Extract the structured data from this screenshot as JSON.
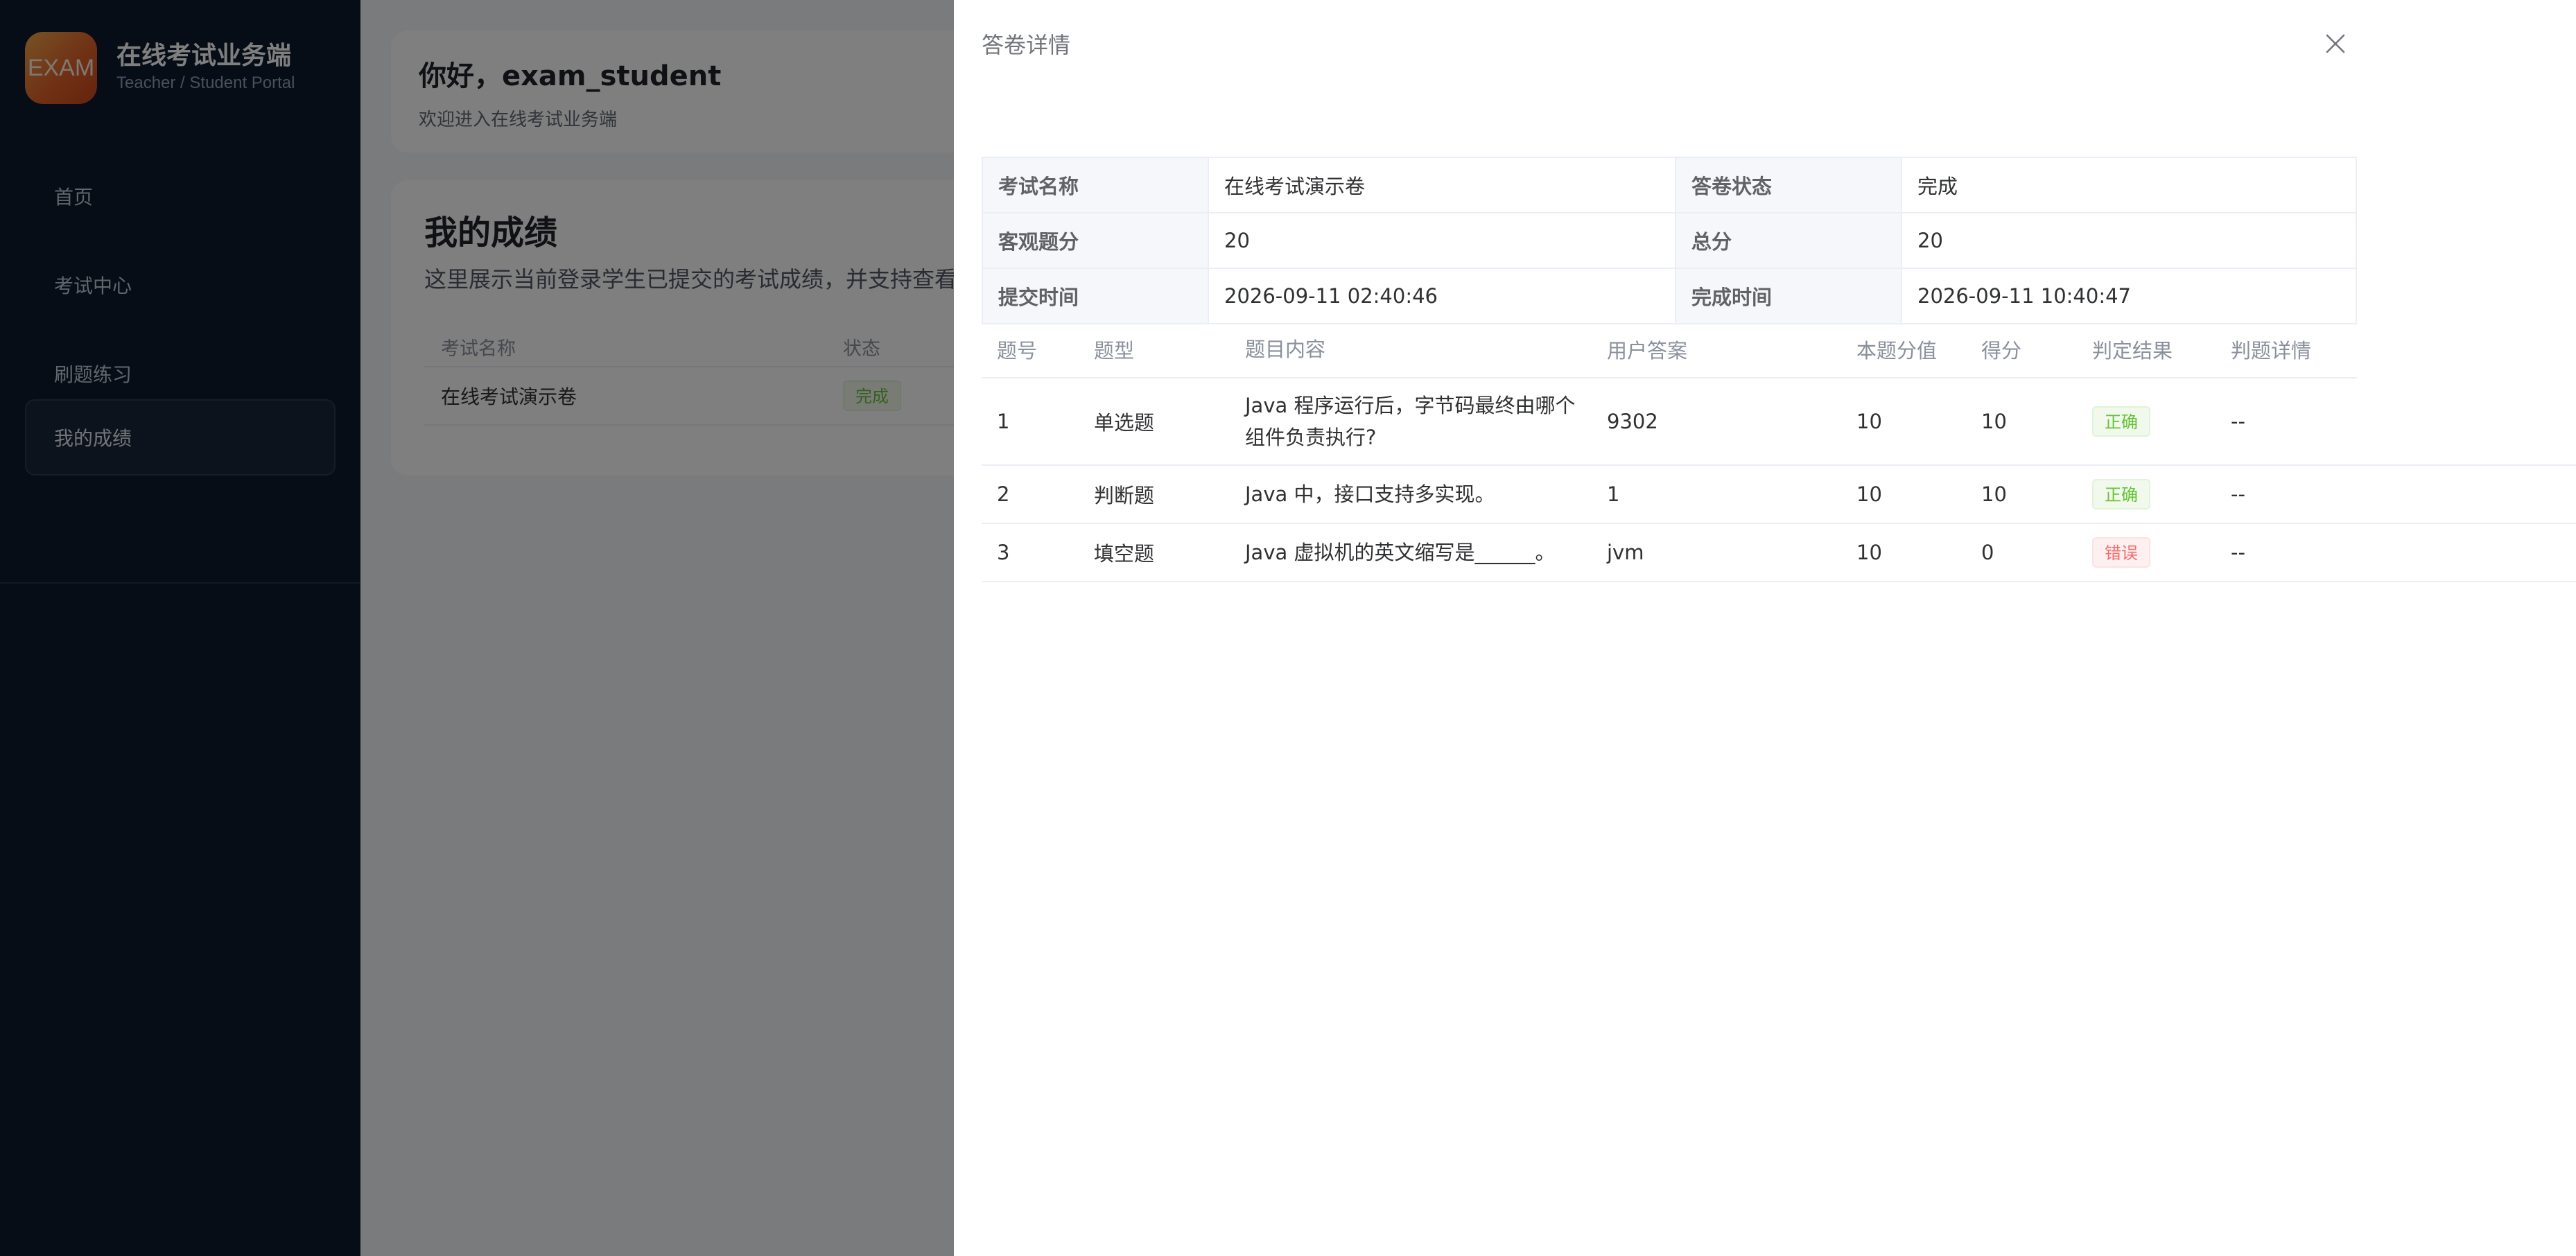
{
  "app": {
    "logo_text": "EXAM",
    "title": "在线考试业务端",
    "subtitle": "Teacher / Student Portal"
  },
  "sidebar": {
    "items": [
      {
        "label": "首页"
      },
      {
        "label": "考试中心"
      },
      {
        "label": "刷题练习"
      },
      {
        "label": "我的成绩",
        "active": true
      }
    ]
  },
  "welcome": {
    "title": "你好，exam_student",
    "subtitle": "欢迎进入在线考试业务端"
  },
  "scores": {
    "title": "我的成绩",
    "description": "这里展示当前登录学生已提交的考试成绩，并支持查看",
    "columns": [
      "考试名称",
      "状态"
    ],
    "rows": [
      {
        "name": "在线考试演示卷",
        "status": "完成"
      }
    ]
  },
  "drawer": {
    "title": "答卷详情",
    "summary": {
      "exam_name_label": "考试名称",
      "exam_name": "在线考试演示卷",
      "status_label": "答卷状态",
      "status": "完成",
      "objective_label": "客观题分",
      "objective": "20",
      "total_label": "总分",
      "total": "20",
      "submit_label": "提交时间",
      "submit_time": "2026-09-11 02:40:46",
      "finish_label": "完成时间",
      "finish_time": "2026-09-11 10:40:47"
    },
    "columns": [
      "题号",
      "题型",
      "题目内容",
      "用户答案",
      "本题分值",
      "得分",
      "判定结果",
      "判题详情"
    ],
    "rows": [
      {
        "no": "1",
        "type": "单选题",
        "content": "Java 程序运行后，字节码最终由哪个组件负责执行?",
        "answer": "9302",
        "score": "10",
        "got": "10",
        "result": "正确",
        "detail": "--"
      },
      {
        "no": "2",
        "type": "判断题",
        "content": "Java 中，接口支持多实现。",
        "answer": "1",
        "score": "10",
        "got": "10",
        "result": "正确",
        "detail": "--"
      },
      {
        "no": "3",
        "type": "填空题",
        "content": "Java 虚拟机的英文缩写是______。",
        "answer": "jvm",
        "score": "10",
        "got": "0",
        "result": "错误",
        "detail": "--"
      }
    ]
  },
  "colors": {
    "sidebar_bg": "#0f1a2e",
    "success": "#67c23a",
    "danger": "#f56c6c"
  }
}
